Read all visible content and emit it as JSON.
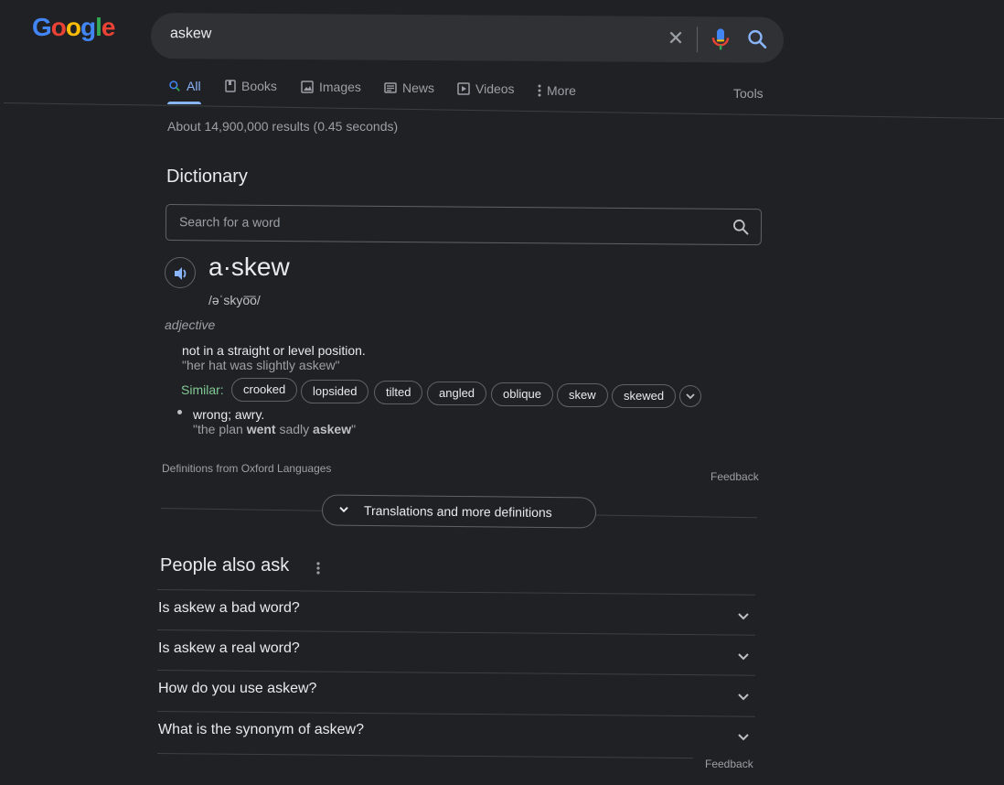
{
  "logo": {
    "text": "Google"
  },
  "search": {
    "query": "askew"
  },
  "tabs": [
    {
      "label": "All"
    },
    {
      "label": "Books"
    },
    {
      "label": "Images"
    },
    {
      "label": "News"
    },
    {
      "label": "Videos"
    },
    {
      "label": "More"
    }
  ],
  "tools_label": "Tools",
  "result_stats": "About 14,900,000 results (0.45 seconds)",
  "dictionary": {
    "title": "Dictionary",
    "search_placeholder": "Search for a word",
    "headword": "a·skew",
    "phonetic": "/əˈskyo͞o/",
    "part_of_speech": "adjective",
    "definitions": [
      {
        "text": "not in a straight or level position.",
        "example": "\"her hat was slightly askew\""
      },
      {
        "text": "wrong; awry.",
        "example_pre": "\"the plan ",
        "example_b1": "went",
        "example_mid": " sadly ",
        "example_b2": "askew",
        "example_post": "\""
      }
    ],
    "similar_label": "Similar:",
    "similar": [
      "crooked",
      "lopsided",
      "tilted",
      "angled",
      "oblique",
      "skew",
      "skewed"
    ],
    "source": "Definitions from Oxford Languages",
    "feedback": "Feedback",
    "translations_button": "Translations and more definitions"
  },
  "people_also_ask": {
    "title": "People also ask",
    "questions": [
      "Is askew a bad word?",
      "Is askew a real word?",
      "How do you use askew?",
      "What is the synonym of askew?"
    ],
    "feedback": "Feedback"
  }
}
